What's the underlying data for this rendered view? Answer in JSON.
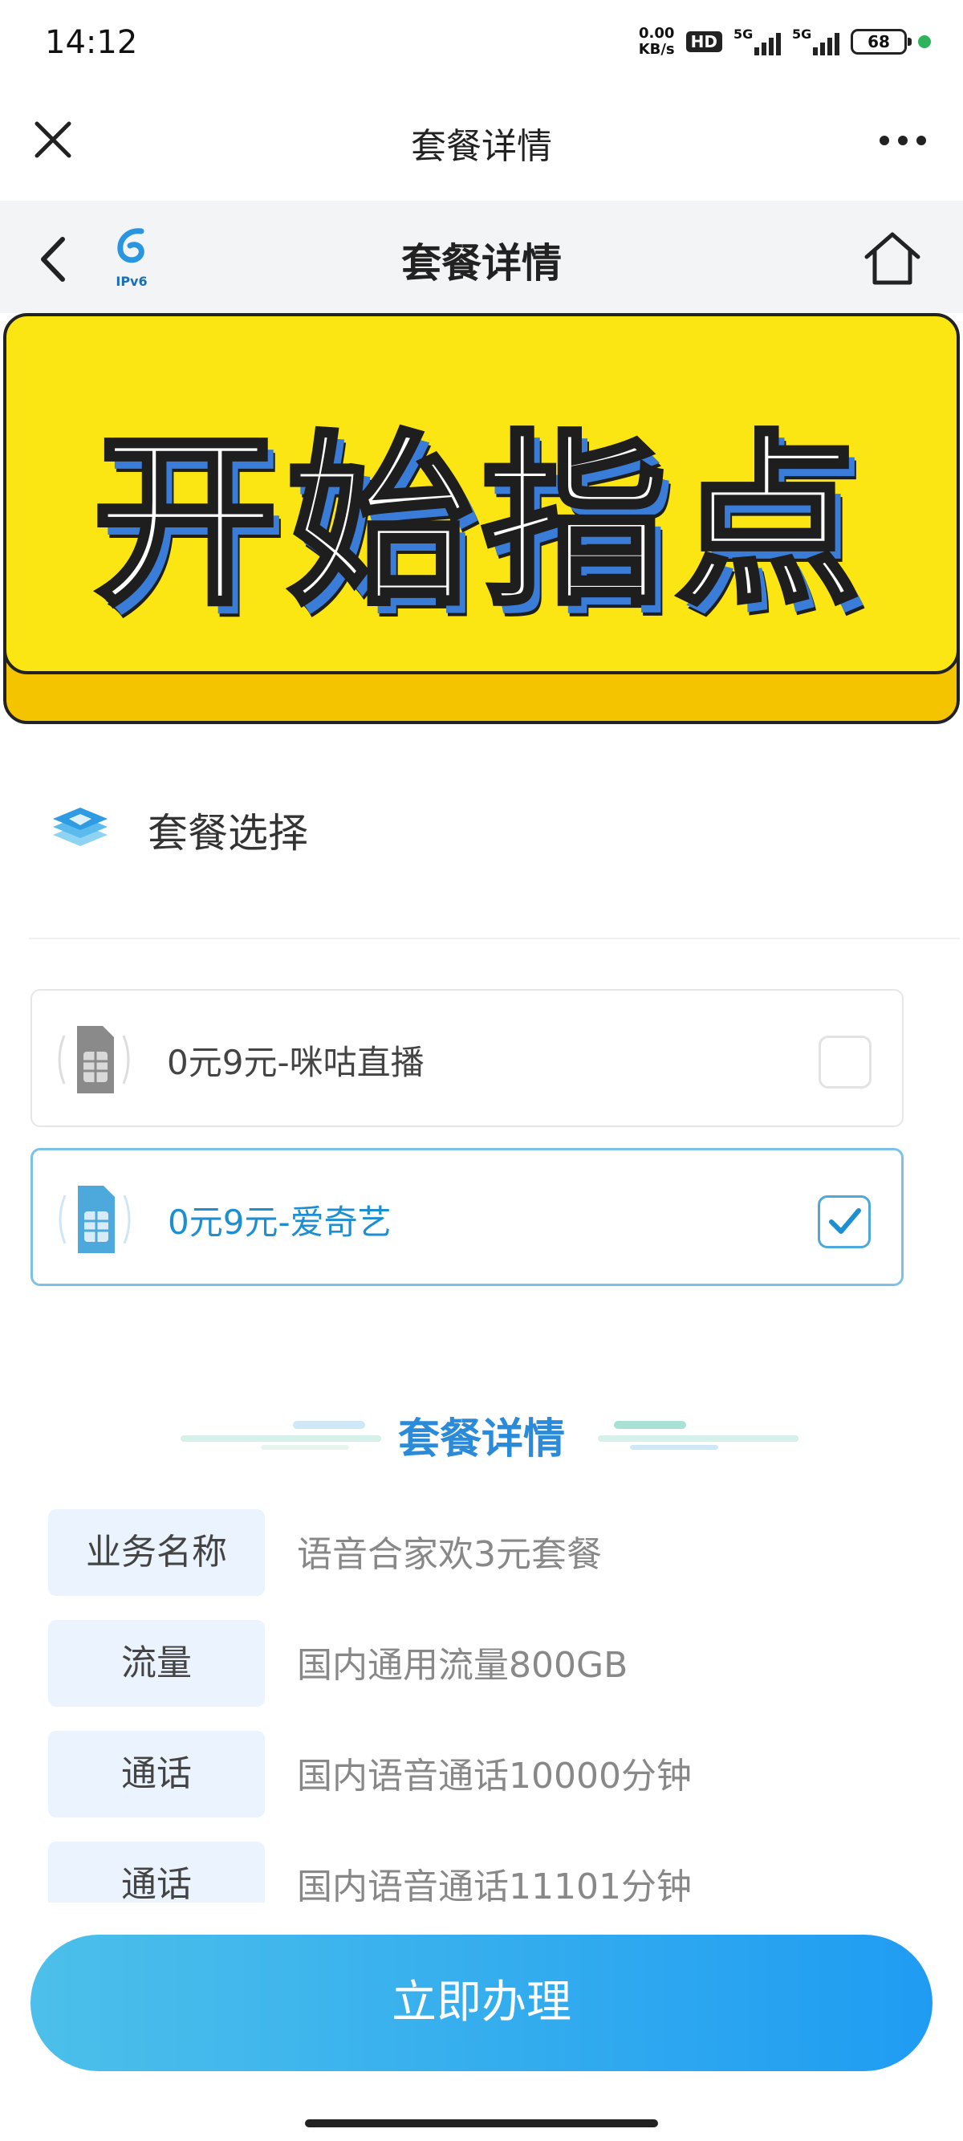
{
  "status_bar": {
    "time": "14:12",
    "net_speed_value": "0.00",
    "net_speed_unit": "KB/s",
    "hd_badge": "HD",
    "signal_1_label": "5G",
    "signal_2_label": "5G",
    "battery": "68"
  },
  "mini_nav": {
    "title": "套餐详情",
    "close_icon": "close-icon",
    "more_icon": "more-icon"
  },
  "page_header": {
    "title": "套餐详情",
    "logo_text": "IPv6",
    "back_icon": "chevron-left-icon",
    "home_icon": "home-icon"
  },
  "banner": {
    "text": "开始指点",
    "colors": {
      "front": "#fbe512",
      "back": "#f5c400",
      "shadow": "#3a7dd8"
    }
  },
  "plan_select": {
    "title": "套餐选择",
    "icon": "layers-icon",
    "options": [
      {
        "label": "0元9元-咪咕直播",
        "checked": false
      },
      {
        "label": "0元9元-爱奇艺",
        "checked": true
      }
    ]
  },
  "details": {
    "title": "套餐详情",
    "rows": [
      {
        "key": "业务名称",
        "value": "语音合家欢3元套餐"
      },
      {
        "key": "流量",
        "value": "国内通用流量800GB"
      },
      {
        "key": "通话",
        "value": "国内语音通话10000分钟"
      },
      {
        "key": "通话",
        "value": "国内语音通话11101分钟"
      }
    ]
  },
  "submit": {
    "label": "立即办理"
  },
  "colors": {
    "accent": "#1f9cf2",
    "selected_border": "#7cc1e8",
    "key_bg": "#eaf3fe"
  }
}
